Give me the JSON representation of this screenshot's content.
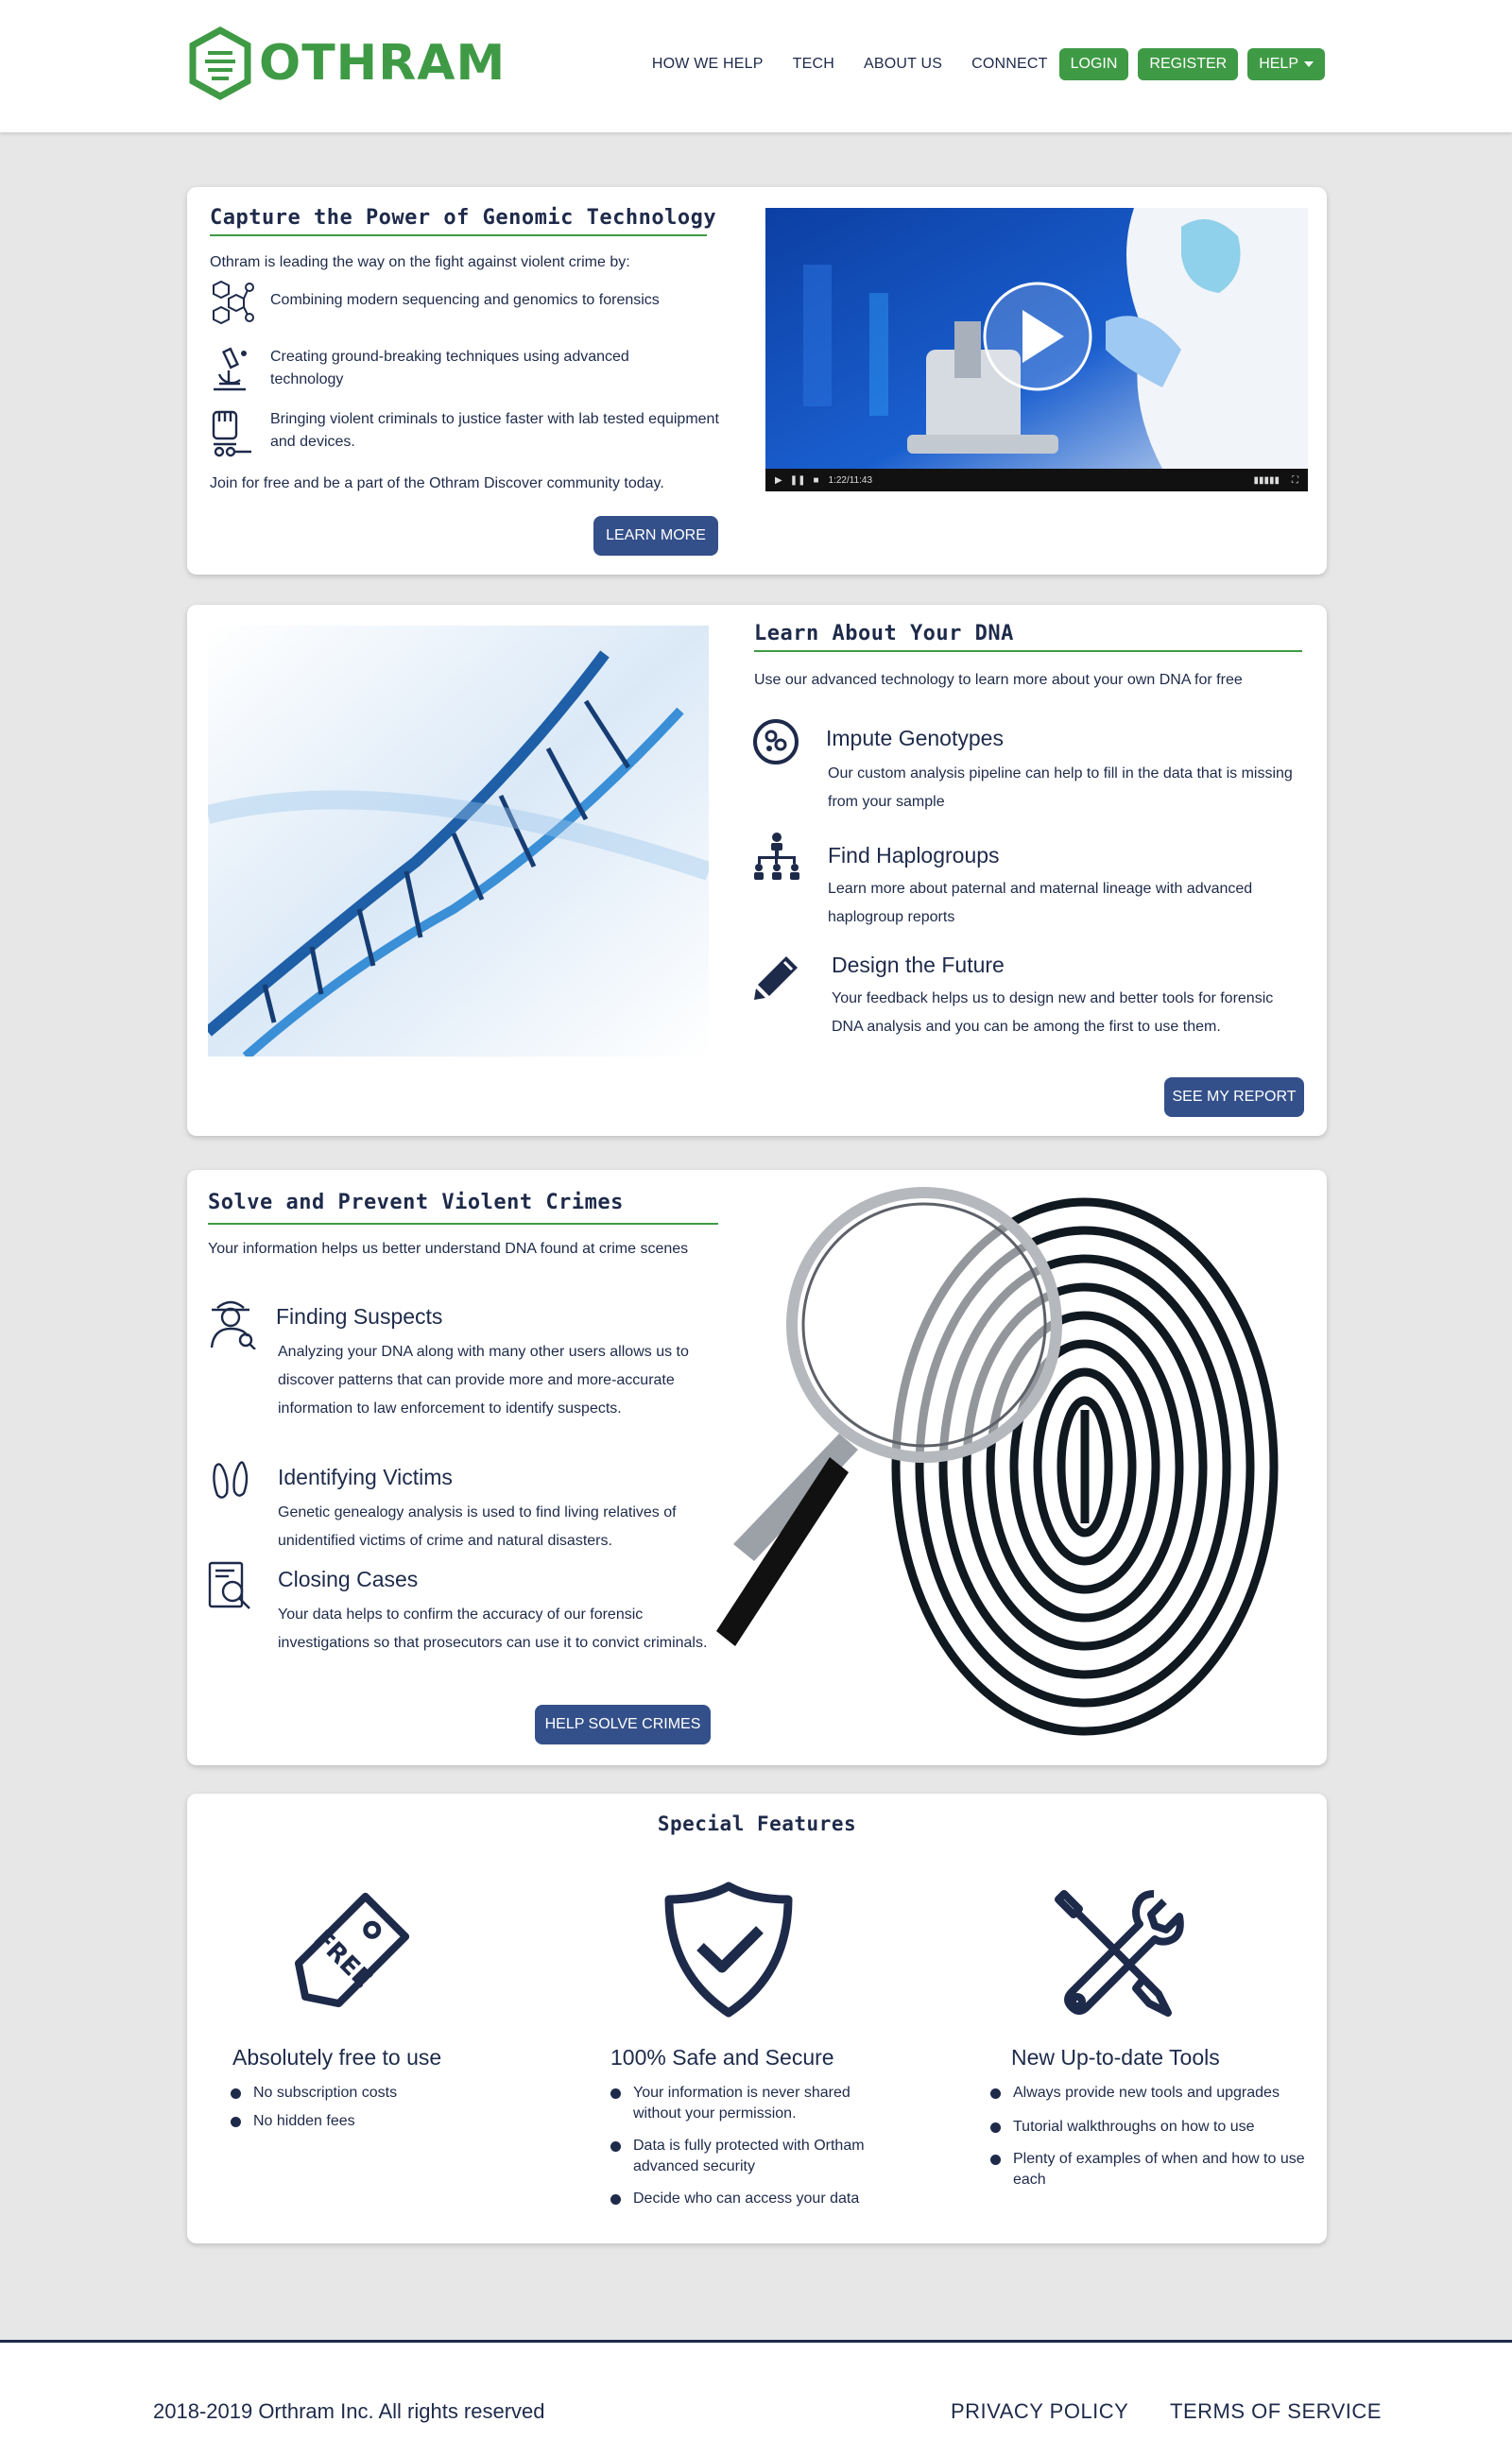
{
  "brand": {
    "logo_text": "OTHRAM",
    "accent": "#3f9a45",
    "navy": "#1e2a4a",
    "button_blue": "#34508a"
  },
  "nav": {
    "links": [
      "HOW WE HELP",
      "TECH",
      "ABOUT US",
      "CONNECT"
    ],
    "login": "LOGIN",
    "register": "REGISTER",
    "help": "HELP"
  },
  "capture": {
    "title": "Capture the Power of Genomic Technology",
    "intro": "Othram is leading the way on the fight against violent crime by:",
    "items": [
      {
        "icon": "molecule-icon",
        "text": "Combining modern sequencing and genomics to forensics"
      },
      {
        "icon": "microscope-icon",
        "text": "Creating ground-breaking techniques using advanced technology"
      },
      {
        "icon": "justice-fist-icon",
        "text": "Bringing violent criminals to justice faster with lab tested equipment and devices."
      }
    ],
    "join": "Join for free and be a part of the Othram Discover community today.",
    "button": "LEARN MORE",
    "video_time": "1:22/11:43"
  },
  "dna": {
    "title": "Learn About Your DNA",
    "intro": "Use our advanced technology to learn more about your own DNA for free",
    "items": [
      {
        "icon": "cell-icon",
        "title": "Impute Genotypes",
        "text": "Our custom analysis pipeline can help to fill in the data that is missing from your sample"
      },
      {
        "icon": "hierarchy-icon",
        "title": "Find Haplogroups",
        "text": "Learn more about paternal and maternal lineage with advanced haplogroup reports"
      },
      {
        "icon": "pencil-icon",
        "title": "Design the Future",
        "text": "Your feedback helps us to design new and better tools for forensic DNA analysis and you can be among the first to use them."
      }
    ],
    "button": "SEE MY REPORT"
  },
  "crimes": {
    "title": "Solve and Prevent Violent Crimes",
    "intro": "Your information helps us better understand DNA found at crime scenes",
    "items": [
      {
        "icon": "detective-icon",
        "title": "Finding Suspects",
        "text": "Analyzing your DNA along with many other users allows us to discover patterns that can provide more and more-accurate information to law enforcement to identify suspects."
      },
      {
        "icon": "footprints-icon",
        "title": "Identifying Victims",
        "text": "Genetic genealogy analysis is used to find living relatives of unidentified victims of crime and natural disasters."
      },
      {
        "icon": "document-search-icon",
        "title": "Closing Cases",
        "text": "Your data helps to confirm the accuracy of our forensic investigations so that prosecutors can use it to convict criminals."
      }
    ],
    "button": "HELP SOLVE CRIMES"
  },
  "features": {
    "title": "Special Features",
    "tag_text": "FREE",
    "columns": [
      {
        "icon": "free-tag-icon",
        "title": "Absolutely free to use",
        "bullets": [
          "No subscription costs",
          "No hidden fees"
        ]
      },
      {
        "icon": "shield-check-icon",
        "title": "100% Safe and Secure",
        "bullets": [
          "Your information is never shared without your permission.",
          "Data is fully protected with Ortham advanced security",
          "Decide who can access your data"
        ]
      },
      {
        "icon": "tools-icon",
        "title": "New Up-to-date Tools",
        "bullets": [
          "Always provide new tools and upgrades",
          "Tutorial walkthroughs on how to use",
          "Plenty of examples of when and how to use each"
        ]
      }
    ]
  },
  "footer": {
    "copyright": "2018-2019 Orthram Inc. All rights reserved",
    "privacy": "PRIVACY POLICY",
    "terms": "TERMS OF SERVICE"
  }
}
